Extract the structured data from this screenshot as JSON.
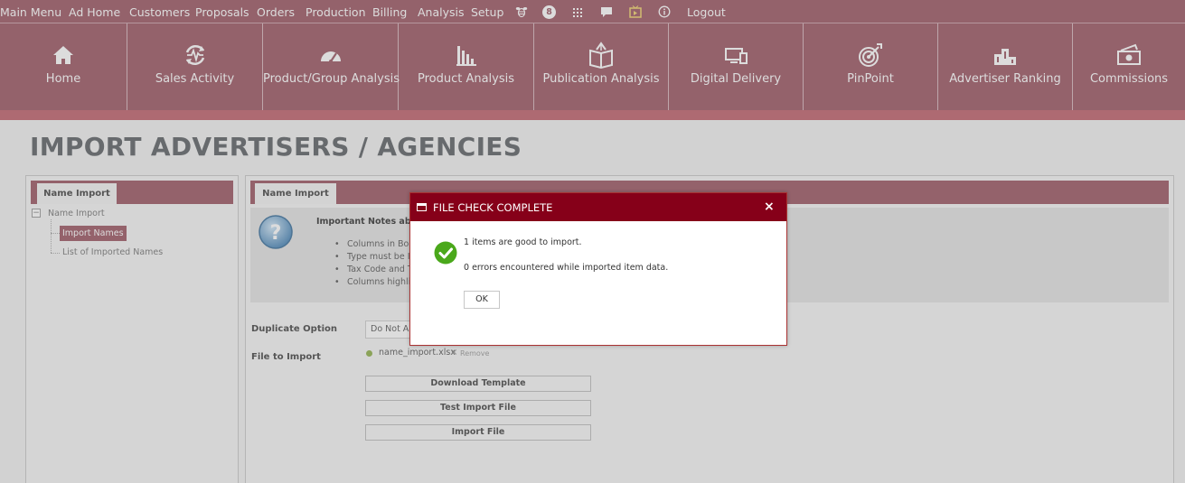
{
  "top_menu": [
    {
      "label": "Main Menu"
    },
    {
      "label": "Ad Home"
    },
    {
      "label": "Customers"
    },
    {
      "label": "Proposals"
    },
    {
      "label": "Orders"
    },
    {
      "label": "Production"
    },
    {
      "label": "Billing"
    },
    {
      "label": "Analysis"
    },
    {
      "label": "Setup"
    },
    {
      "label": "Logout"
    }
  ],
  "top_icons": {
    "badge_count": "8",
    "names": [
      "bee-icon",
      "notification-badge-icon",
      "apps-grid-icon",
      "chat-icon",
      "tv-icon",
      "info-icon"
    ]
  },
  "modules": [
    {
      "label": "Home",
      "icon": "home-icon"
    },
    {
      "label": "Sales Activity",
      "icon": "sales-activity-icon"
    },
    {
      "label": "Product/Group Analysis",
      "icon": "gauge-icon"
    },
    {
      "label": "Product Analysis",
      "icon": "bar-chart-icon"
    },
    {
      "label": "Publication Analysis",
      "icon": "open-book-icon"
    },
    {
      "label": "Digital Delivery",
      "icon": "devices-icon"
    },
    {
      "label": "PinPoint",
      "icon": "target-icon"
    },
    {
      "label": "Advertiser Ranking",
      "icon": "podium-icon"
    },
    {
      "label": "Commissions",
      "icon": "money-icon"
    }
  ],
  "page": {
    "title": "IMPORT ADVERTISERS / AGENCIES"
  },
  "left_panel": {
    "tab": "Name Import",
    "tree_root": "Name Import",
    "tree_items": [
      "Import Names",
      "List of Imported Names"
    ]
  },
  "main_panel": {
    "tab": "Name Import",
    "notes_title": "Important Notes about",
    "notes": [
      "Columns in Bold",
      "Type must be I",
      "Tax Code and T",
      "Columns highlig"
    ],
    "duplicate_label": "Duplicate Option",
    "duplicate_value": "Do Not All",
    "file_label": "File to Import",
    "file_name": "name_import.xlsx",
    "file_remove_x": "×",
    "file_remove": "Remove",
    "buttons": {
      "download": "Download Template",
      "test": "Test Import File",
      "import": "Import File"
    }
  },
  "dialog": {
    "title": "FILE CHECK COMPLETE",
    "close": "×",
    "message1": "1 items are good to import.",
    "message2": "0 errors encountered while imported item data.",
    "ok": "OK"
  },
  "colors": {
    "brand": "#9b5663",
    "brand_light": "#c0616d",
    "dialog_header": "#860019",
    "success": "#4aa81b"
  }
}
